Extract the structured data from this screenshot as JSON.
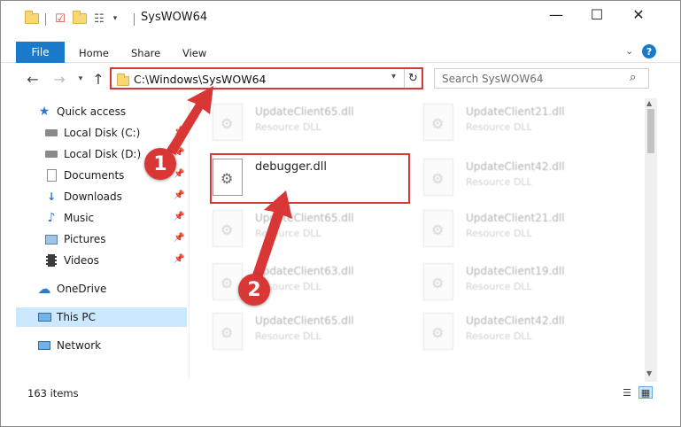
{
  "window": {
    "title": "SysWOW64",
    "controls": {
      "minimize": "—",
      "maximize": "☐",
      "close": "✕"
    }
  },
  "ribbon": {
    "tabs": [
      "File",
      "Home",
      "Share",
      "View"
    ],
    "expand_icon": "chevron-down-icon",
    "help_label": "?"
  },
  "address_bar": {
    "path": "C:\\Windows\\SysWOW64",
    "search_placeholder": "Search SysWOW64"
  },
  "nav_pane": {
    "items": [
      {
        "label": "Quick access",
        "icon": "star-icon"
      },
      {
        "label": "Local Disk (C:)",
        "icon": "drive-icon"
      },
      {
        "label": "Local Disk (D:)",
        "icon": "drive-icon"
      },
      {
        "label": "Documents",
        "icon": "documents-icon"
      },
      {
        "label": "Downloads",
        "icon": "downloads-icon"
      },
      {
        "label": "Music",
        "icon": "music-icon"
      },
      {
        "label": "Pictures",
        "icon": "pictures-icon"
      },
      {
        "label": "Videos",
        "icon": "videos-icon"
      },
      {
        "label": "OneDrive",
        "icon": "cloud-icon"
      },
      {
        "label": "This PC",
        "icon": "computer-icon"
      },
      {
        "label": "Network",
        "icon": "network-icon"
      }
    ],
    "selected": "This PC"
  },
  "files": [
    {
      "name": "UpdateClient65.dll",
      "type": "Resource DLL"
    },
    {
      "name": "UpdateClient21.dll",
      "type": "Resource DLL"
    },
    {
      "name": "debugger.dll",
      "type": ""
    },
    {
      "name": "UpdateClient42.dll",
      "type": "Resource DLL"
    },
    {
      "name": "UpdateClient65.dll",
      "type": "Resource DLL"
    },
    {
      "name": "UpdateClient21.dll",
      "type": "Resource DLL"
    },
    {
      "name": "UpdateClient63.dll",
      "type": "Resource DLL"
    },
    {
      "name": "UpdateClient19.dll",
      "type": "Resource DLL"
    },
    {
      "name": "UpdateClient65.dll",
      "type": "Resource DLL"
    },
    {
      "name": "UpdateClient42.dll",
      "type": "Resource DLL"
    }
  ],
  "status_bar": {
    "item_count": "163 items"
  },
  "annotations": {
    "step1": "1",
    "step2": "2",
    "color": "#d93636"
  }
}
